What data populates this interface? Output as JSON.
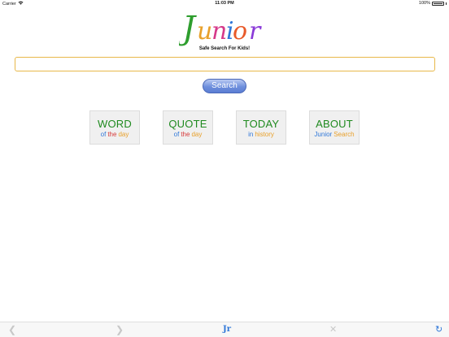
{
  "status": {
    "carrier": "Carrier",
    "time": "11:03 PM",
    "battery": "100%"
  },
  "logo": {
    "letters": [
      {
        "ch": "J",
        "color": "#2f9e2f"
      },
      {
        "ch": "u",
        "color": "#e8a02a"
      },
      {
        "ch": "n",
        "color": "#d63a8a"
      },
      {
        "ch": "i",
        "color": "#2f77d8"
      },
      {
        "ch": "o",
        "color": "#e85a2a"
      },
      {
        "ch": "r",
        "color": "#8a3ad8"
      }
    ]
  },
  "tagline": "Safe Search For Kids!",
  "search": {
    "value": "",
    "placeholder": "",
    "button_label": "Search"
  },
  "tiles": [
    {
      "title": "WORD",
      "title_color": "#1f8a1f",
      "sub": [
        {
          "t": "of",
          "c": "#2f77d8"
        },
        {
          "t": "the",
          "c": "#d63a3a"
        },
        {
          "t": "day",
          "c": "#e8a02a"
        }
      ]
    },
    {
      "title": "QUOTE",
      "title_color": "#1f8a1f",
      "sub": [
        {
          "t": "of",
          "c": "#2f77d8"
        },
        {
          "t": "the",
          "c": "#d63a3a"
        },
        {
          "t": "day",
          "c": "#e8a02a"
        }
      ]
    },
    {
      "title": "TODAY",
      "title_color": "#1f8a1f",
      "sub": [
        {
          "t": "in",
          "c": "#2f77d8"
        },
        {
          "t": "history",
          "c": "#e8a02a"
        }
      ]
    },
    {
      "title": "ABOUT",
      "title_color": "#1f8a1f",
      "sub": [
        {
          "t": "Junior",
          "c": "#2f77d8"
        },
        {
          "t": "Search",
          "c": "#e8a02a"
        }
      ]
    }
  ],
  "toolbar": {
    "logo_text": "Jr",
    "logo_color": "#2f77d8",
    "refresh_color": "#2f77d8"
  }
}
